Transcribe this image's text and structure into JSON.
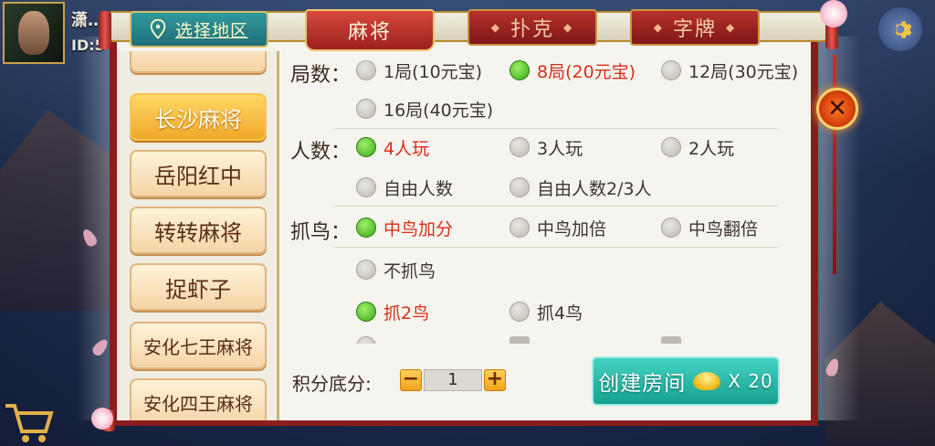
{
  "player": {
    "name": "潇…",
    "id_prefix": "ID:5"
  },
  "header": {
    "region_button": "选择地区",
    "tabs": [
      {
        "label": "麻将",
        "active": true
      },
      {
        "label": "扑克",
        "active": false
      },
      {
        "label": "字牌",
        "active": false
      }
    ]
  },
  "regions": [
    {
      "label": "长沙麻将",
      "active": true
    },
    {
      "label": "岳阳红中",
      "active": false
    },
    {
      "label": "转转麻将",
      "active": false
    },
    {
      "label": "捉虾子",
      "active": false
    },
    {
      "label": "安化七王麻将",
      "active": false
    },
    {
      "label": "安化四王麻将",
      "active": false
    }
  ],
  "options": {
    "rounds": {
      "label": "局数：",
      "choices": [
        {
          "text": "1局(10元宝)",
          "selected": false
        },
        {
          "text": "8局(20元宝)",
          "selected": true
        },
        {
          "text": "12局(30元宝)",
          "selected": false
        },
        {
          "text": "16局(40元宝)",
          "selected": false
        }
      ]
    },
    "players": {
      "label": "人数：",
      "choices": [
        {
          "text": "4人玩",
          "selected": true
        },
        {
          "text": "3人玩",
          "selected": false
        },
        {
          "text": "2人玩",
          "selected": false
        },
        {
          "text": "自由人数",
          "selected": false
        },
        {
          "text": "自由人数2/3人",
          "selected": false
        }
      ]
    },
    "bird": {
      "label": "抓鸟：",
      "choices": [
        {
          "text": "中鸟加分",
          "selected": true
        },
        {
          "text": "中鸟加倍",
          "selected": false
        },
        {
          "text": "中鸟翻倍",
          "selected": false
        },
        {
          "text": "不抓鸟",
          "selected": false
        },
        {
          "text": "抓2鸟",
          "selected": true
        },
        {
          "text": "抓4鸟",
          "selected": false
        }
      ]
    }
  },
  "footer": {
    "score_label": "积分底分:",
    "score_value": "1",
    "minus": "−",
    "plus": "+",
    "create_button": "创建房间",
    "cost": "X 20"
  },
  "close_label": "✕",
  "colors": {
    "accent_red": "#9c1f1f",
    "selected_text": "#d62f1b",
    "teal": "#16a090",
    "gold": "#f1a92a"
  }
}
